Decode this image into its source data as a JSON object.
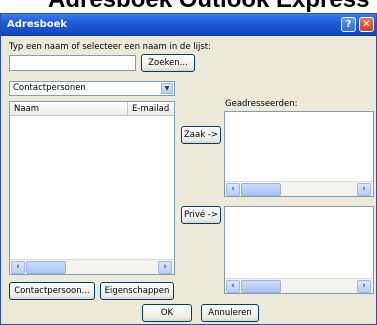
{
  "banner": {
    "text": "Adresboek Outlook Express"
  },
  "window": {
    "title": "Adresboek"
  },
  "titlebar": {
    "help_label": "?",
    "close_label": "✕"
  },
  "search": {
    "prompt_label": "Typ een naam of selecteer een naam in de lijst:",
    "input_value": "",
    "button_label": "Zoeken..."
  },
  "source": {
    "selected": "Contactpersonen",
    "arrow": "▼"
  },
  "contacts": {
    "columns": [
      "Naam",
      "E-mailad"
    ],
    "rows": []
  },
  "recipients": {
    "label": "Geadresseerden:",
    "to_button": "Zaak ->",
    "private_button": "Privé ->"
  },
  "actions": {
    "new_contact": "Contactpersoon...",
    "properties": "Eigenschappen"
  },
  "footer": {
    "ok": "OK",
    "cancel": "Annuleren"
  },
  "scroll": {
    "left": "‹",
    "right": "›"
  }
}
